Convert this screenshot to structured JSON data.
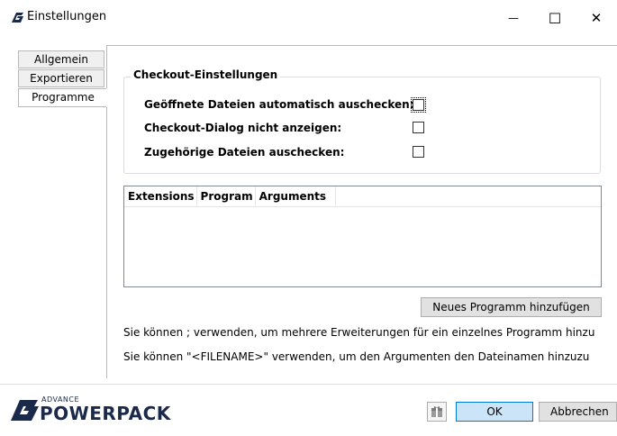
{
  "window": {
    "title": "Einstellungen",
    "minimize_glyph": "—",
    "maximize_glyph": "☐",
    "close_glyph": "✕"
  },
  "tabs": [
    {
      "label": "Allgemein",
      "active": false
    },
    {
      "label": "Exportieren",
      "active": false
    },
    {
      "label": "Programme",
      "active": true
    }
  ],
  "checkout": {
    "title": "Checkout-Einstellungen",
    "options": [
      {
        "label": "Geöffnete Dateien automatisch auschecken:",
        "checked": false
      },
      {
        "label": "Checkout-Dialog nicht anzeigen:",
        "checked": false
      },
      {
        "label": "Zugehörige Dateien auschecken:",
        "checked": false
      }
    ]
  },
  "programs_table": {
    "columns": [
      "Extensions",
      "Program",
      "Arguments"
    ],
    "rows": []
  },
  "add_program_button": "Neues Programm hinzufügen",
  "info_lines": [
    "Sie können ; verwenden, um mehrere Erweiterungen für ein einzelnes Programm hinzu",
    "Sie können \"<FILENAME>\" verwenden, um den Argumenten den Dateinamen hinzuzu"
  ],
  "footer": {
    "logo_top": "ADVANCE",
    "logo_main": "POWERPACK",
    "ok_label": "OK",
    "cancel_label": "Abbrechen"
  },
  "colors": {
    "logo": "#1b2a4a",
    "button_bg": "#e1e1e1",
    "ok_button_bg": "#cce4f7",
    "ok_button_border": "#0078d7"
  }
}
